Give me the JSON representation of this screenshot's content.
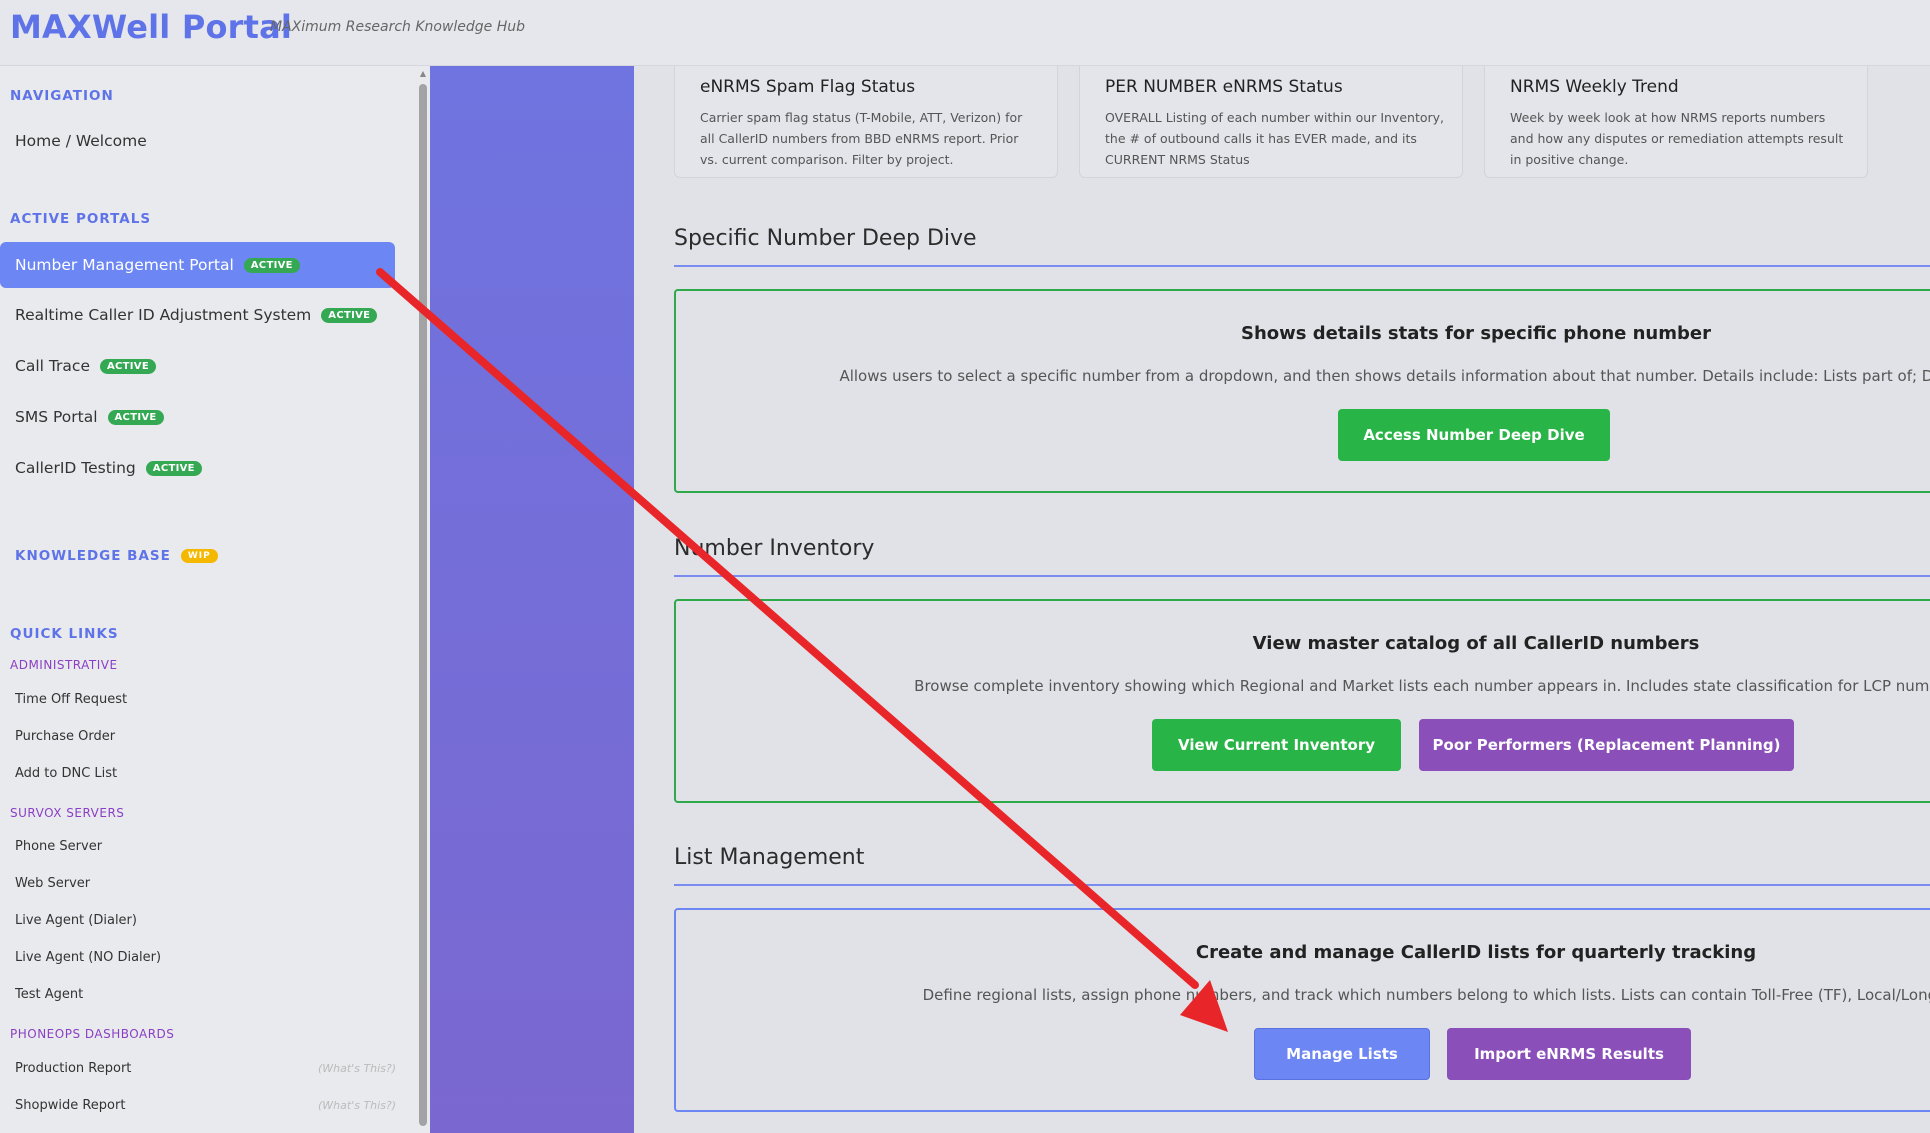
{
  "header": {
    "brand": "MAXWell Portal",
    "tagline": "MAXimum Research Knowledge Hub"
  },
  "sidebar": {
    "navigation_head": "NAVIGATION",
    "home": "Home / Welcome",
    "active_portals_head": "ACTIVE PORTALS",
    "portals": [
      {
        "label": "Number Management Portal",
        "badge": "ACTIVE"
      },
      {
        "label": "Realtime Caller ID Adjustment System",
        "badge": "ACTIVE"
      },
      {
        "label": "Call Trace",
        "badge": "ACTIVE"
      },
      {
        "label": "SMS Portal",
        "badge": "ACTIVE"
      },
      {
        "label": "CallerID Testing",
        "badge": "ACTIVE"
      }
    ],
    "knowledge_base": "KNOWLEDGE BASE",
    "knowledge_badge": "WIP",
    "quick_links_head": "QUICK LINKS",
    "administrative_head": "ADMINISTRATIVE",
    "administrative": [
      "Time Off Request",
      "Purchase Order",
      "Add to DNC List"
    ],
    "survox_head": "SURVOX SERVERS",
    "survox": [
      "Phone Server",
      "Web Server",
      "Live Agent (Dialer)",
      "Live Agent (NO Dialer)",
      "Test Agent"
    ],
    "phoneops_head": "PHONEOPS DASHBOARDS",
    "phoneops": [
      "Production Report",
      "Shopwide Report"
    ],
    "whats_this": "(What's This?)"
  },
  "cards": [
    {
      "title": "eNRMS Spam Flag Status",
      "desc": "Carrier spam flag status (T-Mobile, ATT, Verizon) for all CallerID numbers from BBD eNRMS report. Prior vs. current comparison. Filter by project."
    },
    {
      "title": "PER NUMBER eNRMS Status",
      "desc": "OVERALL Listing of each number within our Inventory, the # of outbound calls it has EVER made, and its CURRENT NRMS Status"
    },
    {
      "title": "NRMS Weekly Trend",
      "desc": "Week by week look at how NRMS reports numbers and how any disputes or remediation attempts result in positive change."
    }
  ],
  "sections": {
    "deep_dive": {
      "title": "Specific Number Deep Dive",
      "panel_title": "Shows details stats for specific phone number",
      "panel_desc": "Allows users to select a specific number from a dropdown, and then shows details information about that number. Details include: Lists part of; Dials/Pickups/Contacts; D",
      "button": "Access Number Deep Dive"
    },
    "inventory": {
      "title": "Number Inventory",
      "panel_title": "View master catalog of all CallerID numbers",
      "panel_desc": "Browse complete inventory showing which Regional and Market lists each number appears in. Includes state classification for LCP numbers and optio",
      "button1": "View Current Inventory",
      "button2": "Poor Performers (Replacement Planning)"
    },
    "list_mgmt": {
      "title": "List Management",
      "panel_title": "Create and manage CallerID lists for quarterly tracking",
      "panel_desc": "Define regional lists, assign phone numbers, and track which numbers belong to which lists. Lists can contain Toll-Free (TF), Local/Long Code (LCP),",
      "button1": "Manage Lists",
      "button2": "Import eNRMS Results"
    }
  },
  "colors": {
    "accent": "#6c86f3",
    "green": "#28b446",
    "purple": "#8a4fb8",
    "arrow": "#e8262a"
  }
}
